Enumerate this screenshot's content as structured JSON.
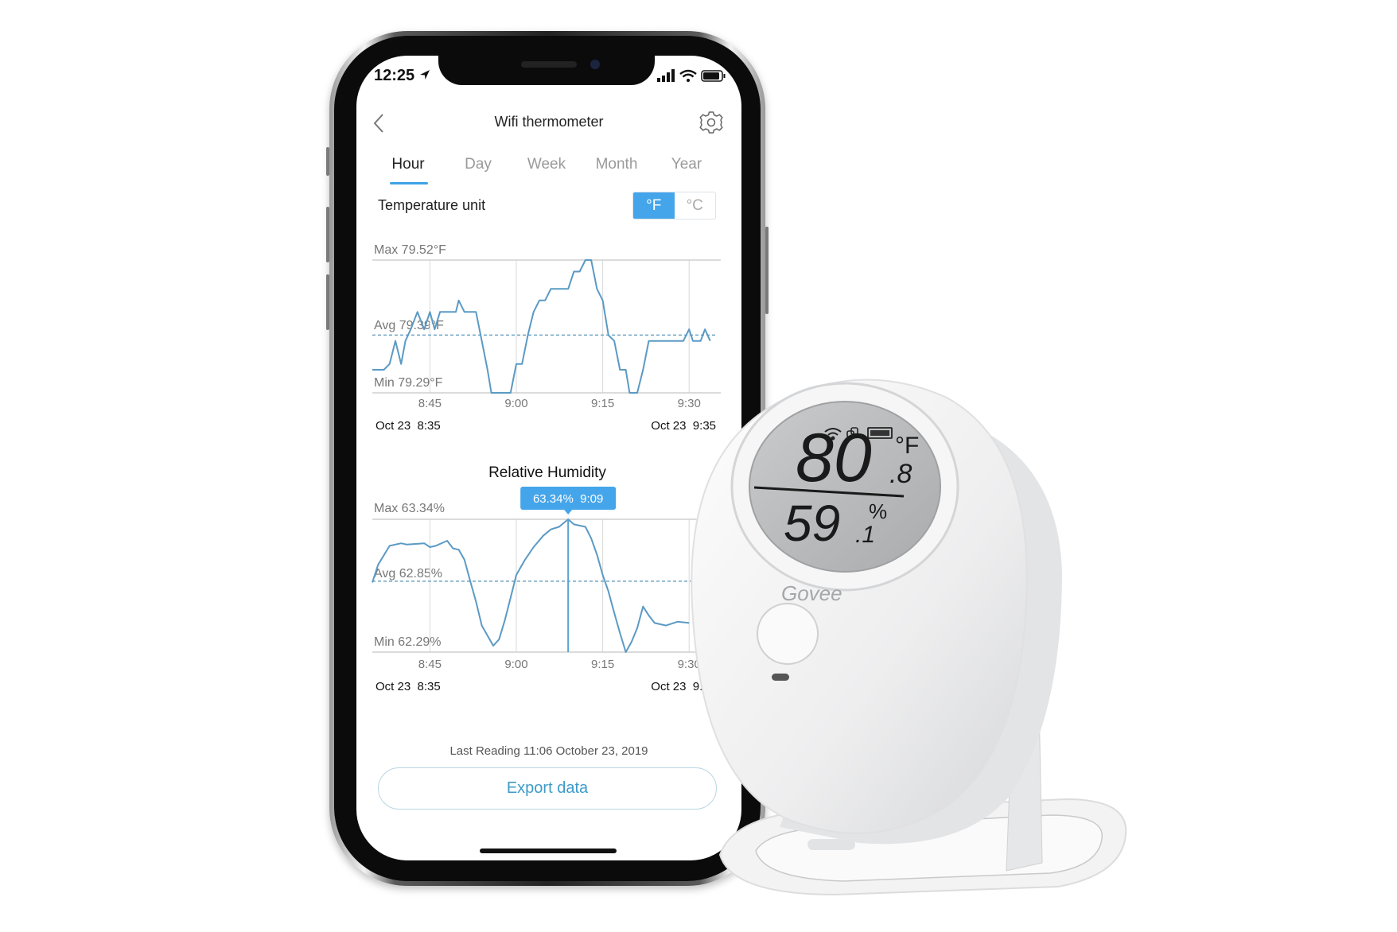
{
  "status_bar": {
    "time": "12:25",
    "icons": [
      "location-arrow-icon",
      "signal-icon",
      "wifi-icon",
      "battery-icon"
    ]
  },
  "header": {
    "title": "Wifi thermometer",
    "back_icon": "chevron-left-icon",
    "settings_icon": "gear-icon"
  },
  "tabs": [
    {
      "label": "Hour",
      "active": true
    },
    {
      "label": "Day",
      "active": false
    },
    {
      "label": "Week",
      "active": false
    },
    {
      "label": "Month",
      "active": false
    },
    {
      "label": "Year",
      "active": false
    }
  ],
  "temperature_unit": {
    "label": "Temperature unit",
    "options": [
      "°F",
      "°C"
    ],
    "selected": "°F"
  },
  "colors": {
    "accent": "#44a5ea",
    "line": "#5b9ac4",
    "grid": "#d8d8d8",
    "export_text": "#3e9bc8"
  },
  "chart_data": [
    {
      "type": "line",
      "title": "",
      "max_label": "Max 79.52°F",
      "avg_label": "Avg 79.39°F",
      "min_label": "Min 79.29°F",
      "ylim": [
        79.29,
        79.52
      ],
      "avg": 79.39,
      "xlim": [
        "8:35",
        "9:35"
      ],
      "x_ticks": [
        "8:45",
        "9:00",
        "9:15",
        "9:30"
      ],
      "start_label": "Oct 23  8:35",
      "end_label": "Oct 23  9:35",
      "grid": true,
      "x": [
        "8:35:00",
        "8:37:00",
        "8:38:00",
        "8:39:00",
        "8:40:00",
        "8:40:45",
        "8:41:40",
        "8:42:50",
        "8:44:00",
        "8:45:00",
        "8:45:50",
        "8:46:45",
        "8:49:30",
        "8:50:00",
        "8:51:00",
        "8:53:00",
        "8:54:00",
        "8:55:00",
        "8:55:40",
        "8:59:00",
        "9:00:00",
        "9:01:00",
        "9:02:00",
        "9:03:00",
        "9:04:00",
        "9:05:00",
        "9:06:00",
        "9:09:00",
        "9:10:00",
        "9:11:00",
        "9:12:00",
        "9:13:00",
        "9:14:00",
        "9:15:00",
        "9:16:00",
        "9:17:00",
        "9:18:00",
        "9:19:00",
        "9:19:40",
        "9:21:00",
        "9:22:00",
        "9:23:00",
        "9:29:00",
        "9:30:00",
        "9:30:40",
        "9:32:00",
        "9:32:45",
        "9:33:40"
      ],
      "y": [
        79.33,
        79.33,
        79.34,
        79.38,
        79.34,
        79.38,
        79.4,
        79.43,
        79.4,
        79.43,
        79.4,
        79.43,
        79.43,
        79.45,
        79.43,
        79.43,
        79.38,
        79.33,
        79.29,
        79.29,
        79.34,
        79.34,
        79.39,
        79.43,
        79.45,
        79.45,
        79.47,
        79.47,
        79.5,
        79.5,
        79.52,
        79.52,
        79.47,
        79.45,
        79.39,
        79.38,
        79.33,
        79.33,
        79.29,
        79.29,
        79.33,
        79.38,
        79.38,
        79.4,
        79.38,
        79.38,
        79.4,
        79.38
      ]
    },
    {
      "type": "line",
      "title": "Relative Humidity",
      "max_label": "Max 63.34%",
      "avg_label": "Avg 62.85%",
      "min_label": "Min 62.29%",
      "ylim": [
        62.29,
        63.34
      ],
      "avg": 62.85,
      "xlim": [
        "8:35",
        "9:35"
      ],
      "x_ticks": [
        "8:45",
        "9:00",
        "9:15",
        "9:30"
      ],
      "start_label": "Oct 23  8:35",
      "end_label": "Oct 23  9:35",
      "grid": true,
      "tooltip": {
        "text": "63.34%  9:09",
        "x": "9:09:00",
        "y": 63.34
      },
      "x": [
        "8:35:00",
        "8:36:00",
        "8:38:00",
        "8:40:00",
        "8:41:00",
        "8:44:00",
        "8:45:00",
        "8:46:00",
        "8:48:00",
        "8:49:00",
        "8:50:00",
        "8:51:00",
        "8:52:00",
        "8:53:00",
        "8:54:00",
        "8:56:00",
        "8:57:00",
        "8:58:00",
        "8:59:00",
        "9:00:00",
        "9:01:30",
        "9:03:00",
        "9:04:40",
        "9:06:00",
        "9:07:25",
        "9:09:00",
        "9:10:00",
        "9:12:00",
        "9:13:00",
        "9:14:00",
        "9:15:00",
        "9:16:00",
        "9:17:00",
        "9:18:00",
        "9:19:00",
        "9:20:00",
        "9:21:00",
        "9:22:00",
        "9:23:00",
        "9:24:00",
        "9:26:00",
        "9:28:00",
        "9:30:00"
      ],
      "y": [
        62.84,
        62.98,
        63.13,
        63.15,
        63.14,
        63.15,
        63.12,
        63.13,
        63.17,
        63.11,
        63.1,
        63.02,
        62.85,
        62.69,
        62.5,
        62.34,
        62.39,
        62.54,
        62.72,
        62.9,
        63.02,
        63.12,
        63.21,
        63.26,
        63.28,
        63.34,
        63.3,
        63.28,
        63.19,
        63.06,
        62.9,
        62.77,
        62.6,
        62.44,
        62.29,
        62.37,
        62.48,
        62.65,
        62.58,
        62.52,
        62.5,
        62.53,
        62.52
      ]
    }
  ],
  "footer": {
    "last_reading": "Last Reading 11:06 October 23, 2019",
    "export_label": "Export data"
  },
  "device": {
    "brand": "Govee",
    "temperature": "80",
    "temperature_decimal": ".8",
    "temperature_unit": "°F",
    "humidity": "59",
    "humidity_decimal": ".1",
    "humidity_unit": "%",
    "lcd_icons": [
      "wifi-icon",
      "link-icon",
      "battery-icon"
    ]
  }
}
